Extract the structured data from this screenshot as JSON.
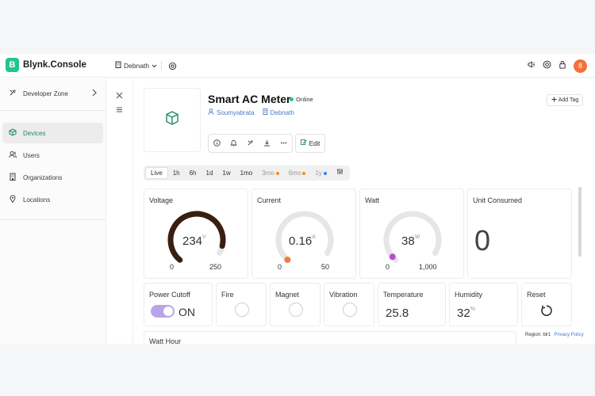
{
  "app": {
    "brand_letter": "B",
    "brand_name": "Blynk.Console"
  },
  "topbar": {
    "org_name": "Debnath",
    "avatar_letter": "8"
  },
  "sidebar": {
    "developer_zone": "Developer Zone",
    "items": [
      {
        "label": "Devices",
        "icon": "chip-icon",
        "active": true
      },
      {
        "label": "Users",
        "icon": "users-icon"
      },
      {
        "label": "Organizations",
        "icon": "building-icon"
      },
      {
        "label": "Locations",
        "icon": "pin-icon"
      }
    ]
  },
  "device": {
    "name": "Smart AC Meter",
    "status": "Online",
    "owner": "Soumyabrata",
    "org": "Debnath",
    "add_tag_label": "Add Tag",
    "edit_label": "Edit"
  },
  "time_tabs": [
    {
      "label": "Live",
      "active": true
    },
    {
      "label": "1h"
    },
    {
      "label": "6h"
    },
    {
      "label": "1d"
    },
    {
      "label": "1w"
    },
    {
      "label": "1mo"
    },
    {
      "label": "3mo",
      "locked": true,
      "dot": "#f08c1e"
    },
    {
      "label": "6mo",
      "locked": true,
      "dot": "#f08c1e"
    },
    {
      "label": "1y",
      "locked": true,
      "dot": "#2f84e8"
    }
  ],
  "widgets": {
    "voltage": {
      "title": "Voltage",
      "value": "234",
      "unit": "V",
      "min": "0",
      "max": "250",
      "fraction": 0.936,
      "color": "#3a1f10"
    },
    "current": {
      "title": "Current",
      "value": "0.16",
      "unit": "A",
      "min": "0",
      "max": "50",
      "fraction": 0.0032,
      "color": "#f07a3c"
    },
    "watt": {
      "title": "Watt",
      "value": "38",
      "unit": "W",
      "min": "0",
      "max": "1,000",
      "fraction": 0.038,
      "color": "#b94fd1"
    },
    "unit_consumed": {
      "title": "Unit Consumed",
      "value": "0"
    },
    "power_cutoff": {
      "title": "Power Cutoff",
      "state": "ON"
    },
    "fire": {
      "title": "Fire"
    },
    "magnet": {
      "title": "Magnet"
    },
    "vibration": {
      "title": "Vibration"
    },
    "temperature": {
      "title": "Temperature",
      "value": "25.8"
    },
    "humidity": {
      "title": "Humidity",
      "value": "32",
      "unit": "%"
    },
    "reset": {
      "title": "Reset"
    },
    "watt_hour": {
      "title": "Watt Hour"
    }
  },
  "footer": {
    "region": "Region: blr1",
    "privacy": "Privacy Policy"
  }
}
